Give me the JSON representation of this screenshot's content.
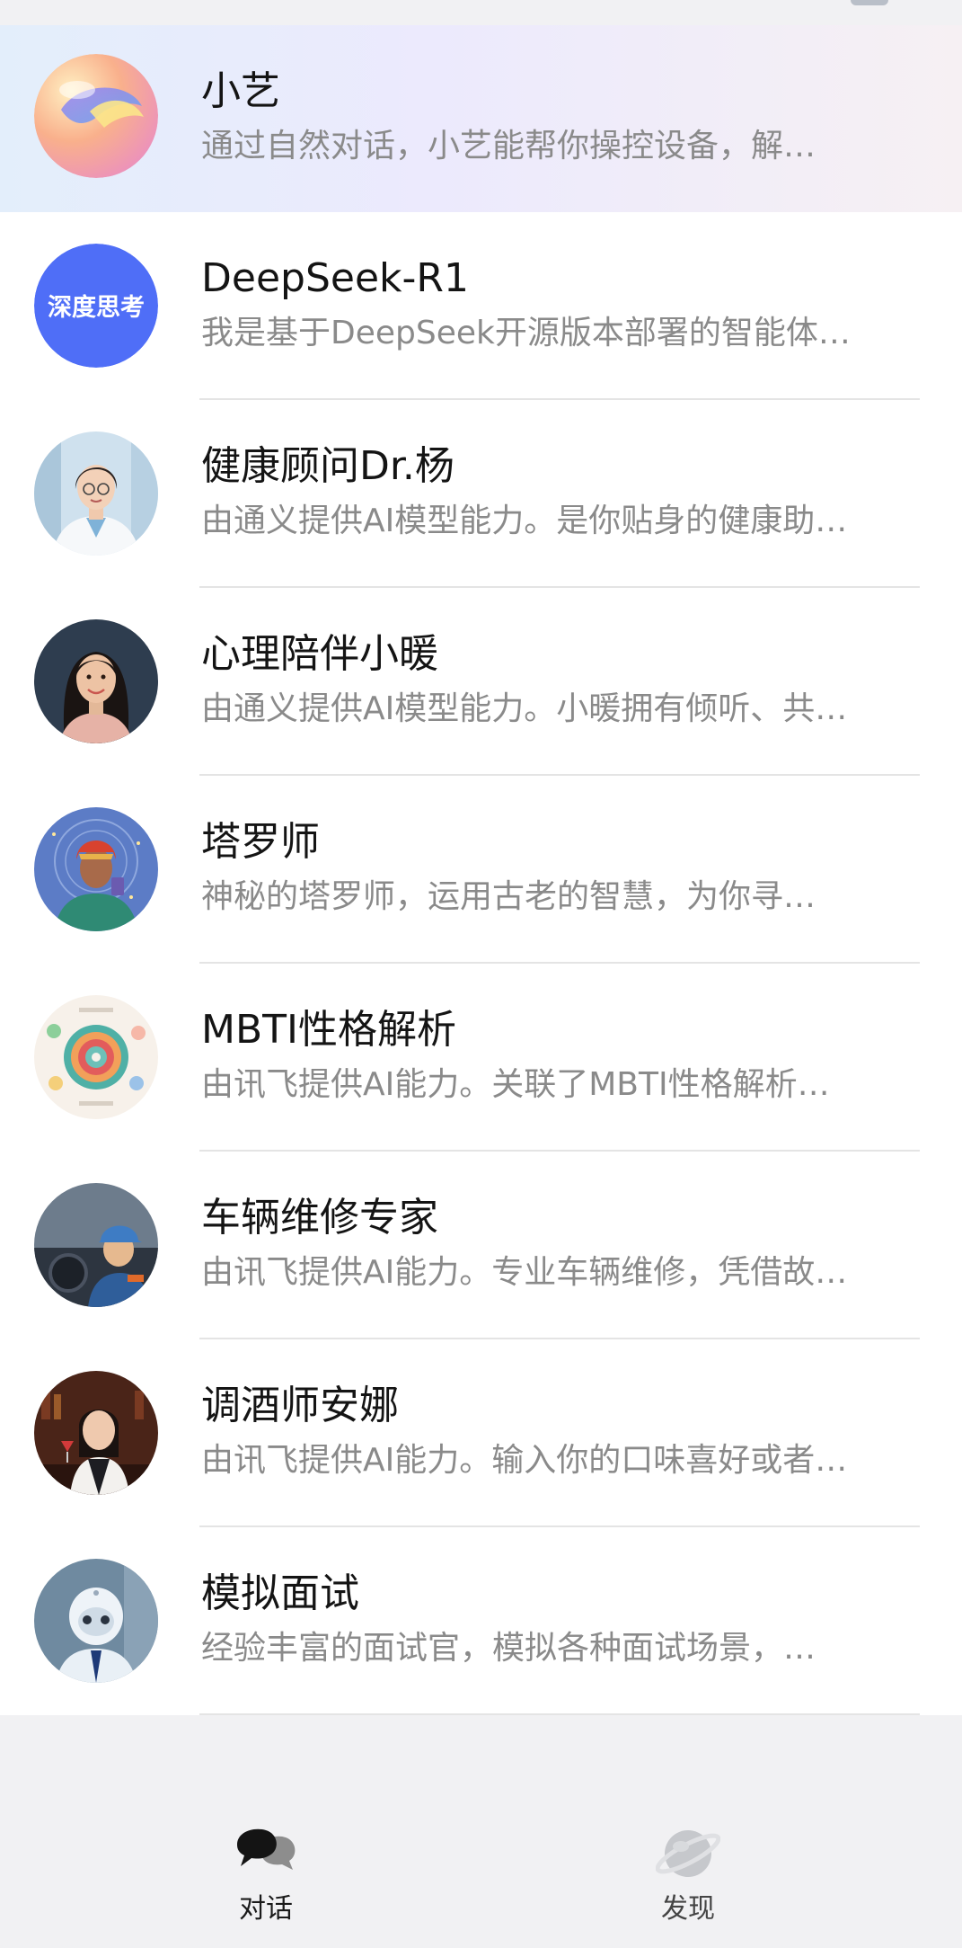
{
  "assistants": [
    {
      "name": "小艺",
      "desc": "通过自然对话，小艺能帮你操控设备，解…",
      "avatar_icon": "xiaoyi-orb-icon"
    },
    {
      "name": "DeepSeek-R1",
      "desc": "我是基于DeepSeek开源版本部署的智能体…",
      "avatar_icon": "deepseek-badge-icon",
      "badge": "深度思考"
    },
    {
      "name": "健康顾问Dr.杨",
      "desc": "由通义提供AI模型能力。是你贴身的健康助…",
      "avatar_icon": "doctor-avatar-icon"
    },
    {
      "name": "心理陪伴小暖",
      "desc": "由通义提供AI模型能力。小暖拥有倾听、共…",
      "avatar_icon": "counselor-avatar-icon"
    },
    {
      "name": "塔罗师",
      "desc": "神秘的塔罗师，运用古老的智慧，为你寻…",
      "avatar_icon": "tarot-avatar-icon"
    },
    {
      "name": "MBTI性格解析",
      "desc": "由讯飞提供AI能力。关联了MBTI性格解析…",
      "avatar_icon": "mbti-chart-avatar-icon"
    },
    {
      "name": "车辆维修专家",
      "desc": "由讯飞提供AI能力。专业车辆维修，凭借故…",
      "avatar_icon": "mechanic-avatar-icon"
    },
    {
      "name": "调酒师安娜",
      "desc": "由讯飞提供AI能力。输入你的口味喜好或者…",
      "avatar_icon": "bartender-avatar-icon"
    },
    {
      "name": "模拟面试",
      "desc": "经验丰富的面试官，模拟各种面试场景，…",
      "avatar_icon": "robot-interviewer-avatar-icon"
    }
  ],
  "bottom_nav": {
    "chat_label": "对话",
    "chat_icon": "chat-bubbles-icon",
    "discover_label": "发现",
    "discover_icon": "planet-icon"
  },
  "colors": {
    "deepseek_badge": "#4f6ef7",
    "title_text": "#141414",
    "desc_text": "#8a8a8a",
    "nav_background": "#f1f1f3"
  }
}
